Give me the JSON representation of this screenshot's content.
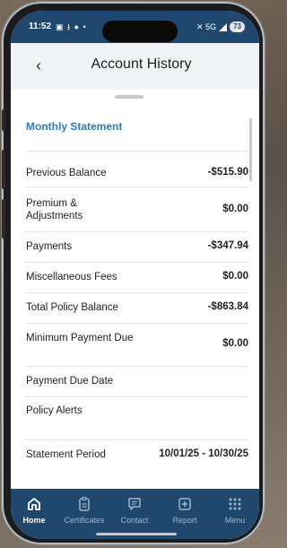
{
  "status_bar": {
    "time": "11:52",
    "left_icons": "▣ ⭳ ● •",
    "network": "✕ 5G",
    "battery": "73"
  },
  "header": {
    "title": "Account History",
    "back_icon": "‹"
  },
  "section": {
    "title": "Monthly Statement"
  },
  "rows": [
    {
      "label": "Previous Balance",
      "value": "-$515.90"
    },
    {
      "label": "Premium & Adjustments",
      "value": "$0.00"
    },
    {
      "label": "Payments",
      "value": "-$347.94"
    },
    {
      "label": "Miscellaneous Fees",
      "value": "$0.00"
    },
    {
      "label": "Total Policy Balance",
      "value": "-$863.84"
    },
    {
      "label": "Minimum Payment Due",
      "value": "$0.00"
    },
    {
      "label": "Payment Due Date",
      "value": ""
    },
    {
      "label": "Policy Alerts",
      "value": ""
    },
    {
      "label": "Statement Period",
      "value": "10/01/25 - 10/30/25"
    }
  ],
  "tabs": [
    {
      "label": "Home",
      "icon": "home-icon",
      "active": true
    },
    {
      "label": "Certificates",
      "icon": "certificate-icon",
      "active": false
    },
    {
      "label": "Contact",
      "icon": "chat-icon",
      "active": false
    },
    {
      "label": "Report",
      "icon": "report-plus-icon",
      "active": false
    },
    {
      "label": "Menu",
      "icon": "grid-menu-icon",
      "active": false
    }
  ],
  "colors": {
    "nav": "#20486e",
    "accent": "#2a7fb8"
  }
}
